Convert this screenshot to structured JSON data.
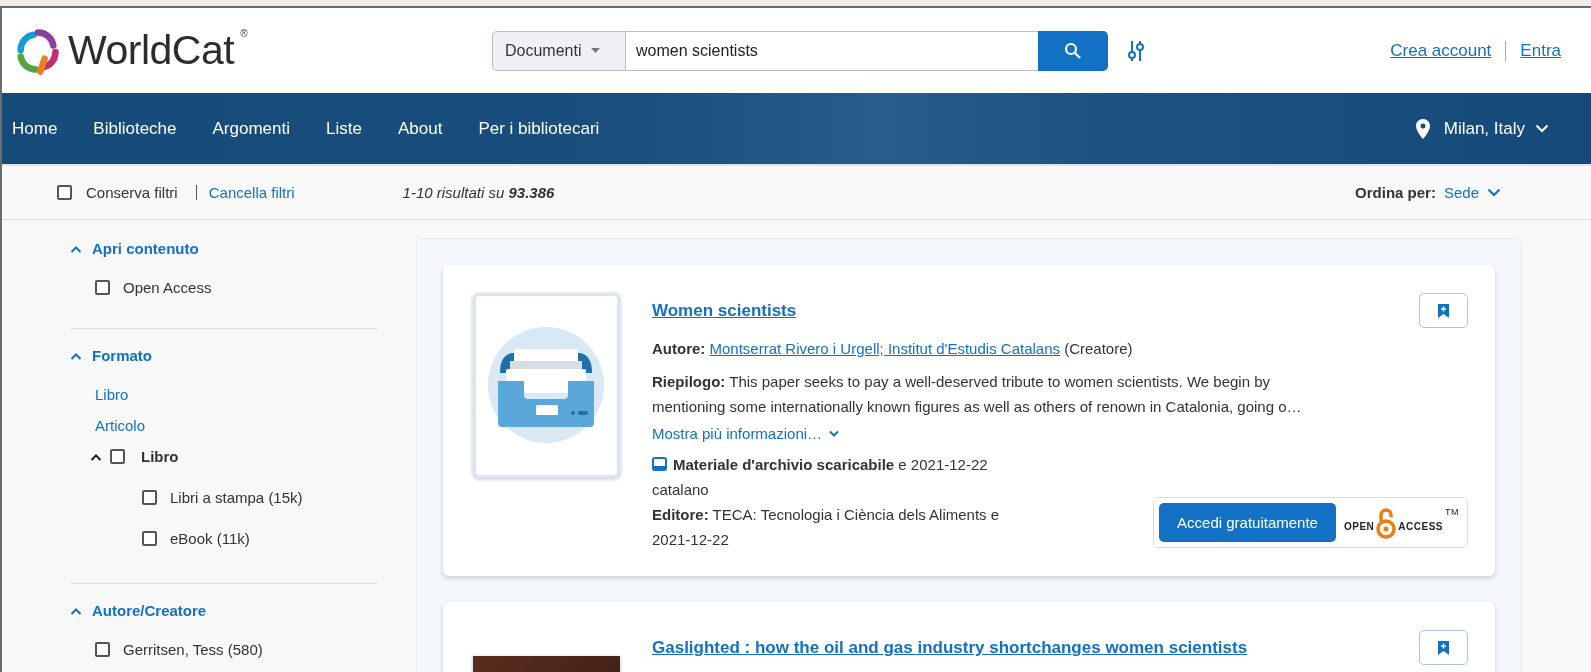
{
  "header": {
    "logo": {
      "name": "WorldCat",
      "mark": "®"
    },
    "search": {
      "scope": "Documenti",
      "value": "women scientists"
    },
    "links": [
      "Crea account",
      "Entra"
    ]
  },
  "nav": {
    "items": [
      "Home",
      "Biblioteche",
      "Argomenti",
      "Liste",
      "About",
      "Per i bibliotecari"
    ],
    "location": "Milan, Italy"
  },
  "toolbar": {
    "keep_filters": {
      "label": "Conserva filtri",
      "checked": false
    },
    "clear_filters": "Cancella filtri",
    "results": "1-10 risultati su **93.386**",
    "sort_label": "Ordina per:",
    "sort_value": "Sede"
  },
  "facets": [
    {
      "title": "Apri contenuto",
      "expanded": true,
      "items": [
        {
          "kind": "checkbox",
          "label": "Open Access",
          "checked": false
        }
      ]
    },
    {
      "title": "Formato",
      "expanded": true,
      "items": [
        {
          "kind": "link",
          "label": "Libro"
        },
        {
          "kind": "link",
          "label": "Articolo"
        },
        {
          "kind": "group",
          "label": "Libro",
          "expanded": true,
          "checked": false,
          "children": [
            {
              "kind": "checkbox",
              "label": "Libri a stampa (15k)",
              "checked": false
            },
            {
              "kind": "checkbox",
              "label": "eBook (11k)",
              "checked": false
            }
          ]
        }
      ]
    },
    {
      "title": "Autore/Creatore",
      "expanded": true,
      "items": [
        {
          "kind": "checkbox",
          "label": "Gerritsen, Tess (580)",
          "checked": false
        }
      ]
    }
  ],
  "results": [
    {
      "kind": "archive",
      "title": "Women scientists",
      "author_label": "Autore:",
      "author": "Montserrat Rivero i Urgell; Institut d'Estudis Catalans",
      "author_role": "(Creatore)",
      "summary": "**Riepilogo:** This paper seeks to pay a well-deserved tribute to women scientists. We begin by mentioning some internationally known figures as well as others of renown in Catalonia, going o…",
      "more": "Mostra più informazioni…",
      "format": "Materiale d'archivio scaricabile",
      "format_date": "e 2021-12-22",
      "language": "catalano",
      "publisher": "**Editore:** TECA: Tecnologia i Ciència dels Aliments e 2021-12-22",
      "access_button": "Accedi gratuitamente",
      "access_logo": {
        "left": "OPEN",
        "right": "ACCESS",
        "mark": "TM"
      }
    },
    {
      "kind": "photo",
      "title": "Gaslighted : how the oil and gas industry shortchanges women scientists"
    }
  ]
}
